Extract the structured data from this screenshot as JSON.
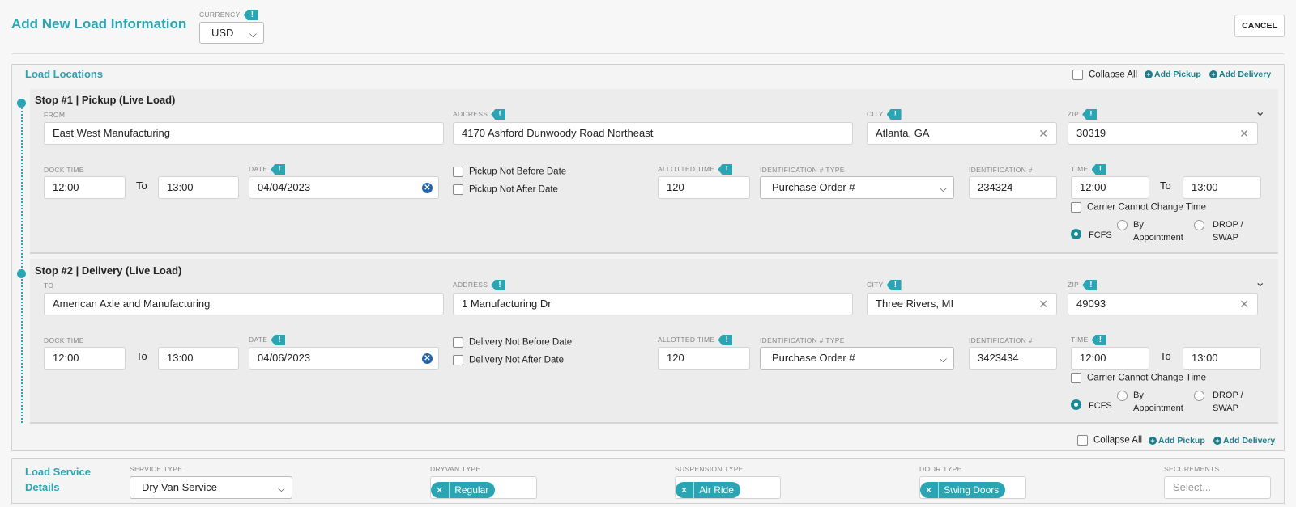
{
  "header": {
    "title": "Add New Load Information",
    "currency_label": "CURRENCY",
    "currency_value": "USD",
    "cancel_label": "CANCEL"
  },
  "locations": {
    "title": "Load Locations",
    "collapse_all": "Collapse All",
    "add_pickup": "Add Pickup",
    "add_delivery": "Add Delivery"
  },
  "labels": {
    "from": "FROM",
    "to_field": "TO",
    "address": "ADDRESS",
    "city": "CITY",
    "zip": "ZIP",
    "dock_time": "DOCK TIME",
    "date": "DATE",
    "allotted_time": "ALLOTTED TIME",
    "id_type": "IDENTIFICATION # TYPE",
    "id_num": "IDENTIFICATION #",
    "time": "TIME",
    "to": "To",
    "carrier_cannot_change": "Carrier Cannot Change Time",
    "fcfs": "FCFS",
    "by_appt_1": "By",
    "by_appt_2": "Appointment",
    "drop_1": "DROP /",
    "drop_2": "SWAP"
  },
  "stops": [
    {
      "title": "Stop #1 | Pickup (Live Load)",
      "party": "East West Manufacturing",
      "address": "4170 Ashford Dunwoody Road Northeast",
      "city": "Atlanta, GA",
      "zip": "30319",
      "dock_from": "12:00",
      "dock_to": "13:00",
      "date": "04/04/2023",
      "not_before": "Pickup Not Before Date",
      "not_after": "Pickup Not After Date",
      "allotted": "120",
      "id_type": "Purchase Order #",
      "id_num": "234324",
      "time_from": "12:00",
      "time_to": "13:00",
      "appointment": "FCFS"
    },
    {
      "title": "Stop #2 | Delivery (Live Load)",
      "party": "American Axle and Manufacturing",
      "address": "1 Manufacturing Dr",
      "city": "Three Rivers, MI",
      "zip": "49093",
      "dock_from": "12:00",
      "dock_to": "13:00",
      "date": "04/06/2023",
      "not_before": "Delivery Not Before Date",
      "not_after": "Delivery Not After Date",
      "allotted": "120",
      "id_type": "Purchase Order #",
      "id_num": "3423434",
      "time_from": "12:00",
      "time_to": "13:00",
      "appointment": "FCFS"
    }
  ],
  "service": {
    "title_1": "Load Service",
    "title_2": "Details",
    "service_type_label": "SERVICE TYPE",
    "service_type": "Dry Van Service",
    "dryvan_label": "DRYVAN TYPE",
    "dryvan": "Regular",
    "suspension_label": "SUSPENSION TYPE",
    "suspension": "Air Ride",
    "door_label": "DOOR TYPE",
    "door": "Swing Doors",
    "securements_label": "SECUREMENTS",
    "securements_placeholder": "Select..."
  },
  "colors": {
    "accent": "#2aa5b3",
    "link": "#1a7d8a",
    "clear_blue": "#2563a8"
  }
}
